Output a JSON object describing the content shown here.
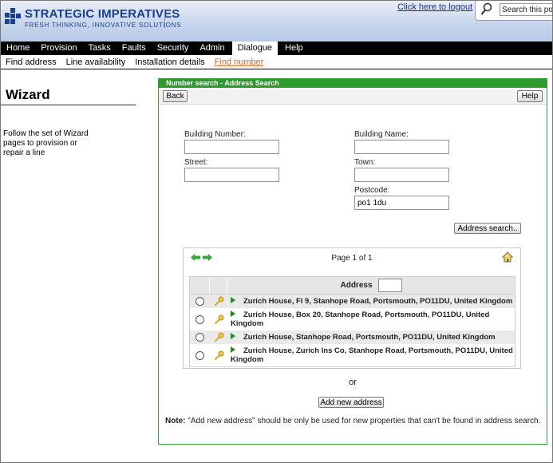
{
  "header": {
    "brand_title": "STRATEGIC IMPERATIVES",
    "brand_tagline": "FRESH THINKING, INNOVATIVE SOLUTIONS",
    "logout_link": "Click here to logout",
    "search_value": "Search this portal",
    "brand_color": "#1a3f8c"
  },
  "nav": {
    "items": [
      "Home",
      "Provision",
      "Tasks",
      "Faults",
      "Security",
      "Admin",
      "Dialogue",
      "Help"
    ],
    "active": "Dialogue"
  },
  "subnav": {
    "items": [
      "Find address",
      "Line availability",
      "Installation details",
      "Find number"
    ],
    "active": "Find number"
  },
  "sidebar": {
    "title": "Wizard",
    "description": "Follow the set of Wizard pages to provision or repair a line"
  },
  "panel": {
    "title": "Number search - Address Search",
    "back_label": "Back",
    "help_label": "Help",
    "accent_color": "#2e9a2e",
    "fields": {
      "building_number": {
        "label": "Building Number:",
        "value": ""
      },
      "building_name": {
        "label": "Building Name:",
        "value": ""
      },
      "street": {
        "label": "Street:",
        "value": ""
      },
      "town": {
        "label": "Town:",
        "value": ""
      },
      "postcode": {
        "label": "Postcode:",
        "value": "po1 1du"
      }
    },
    "address_search_label": "Address search..",
    "results": {
      "page_info": "Page 1 of 1",
      "column_header": "Address",
      "rows": [
        "Zurich House, Fl 9, Stanhope Road, Portsmouth, PO11DU, United Kingdom",
        "Zurich House, Box 20, Stanhope Road, Portsmouth, PO11DU, United Kingdom",
        "Zurich House, Stanhope Road, Portsmouth, PO11DU, United Kingdom",
        "Zurich House, Zurich Ins Co, Stanhope Road, Portsmouth, PO11DU, United Kingdom"
      ]
    },
    "or_text": "or",
    "add_new_label": "Add new address",
    "note_label": "Note:",
    "note_text": " \"Add new address\" should be only be used for new properties that can't be found in address search."
  }
}
